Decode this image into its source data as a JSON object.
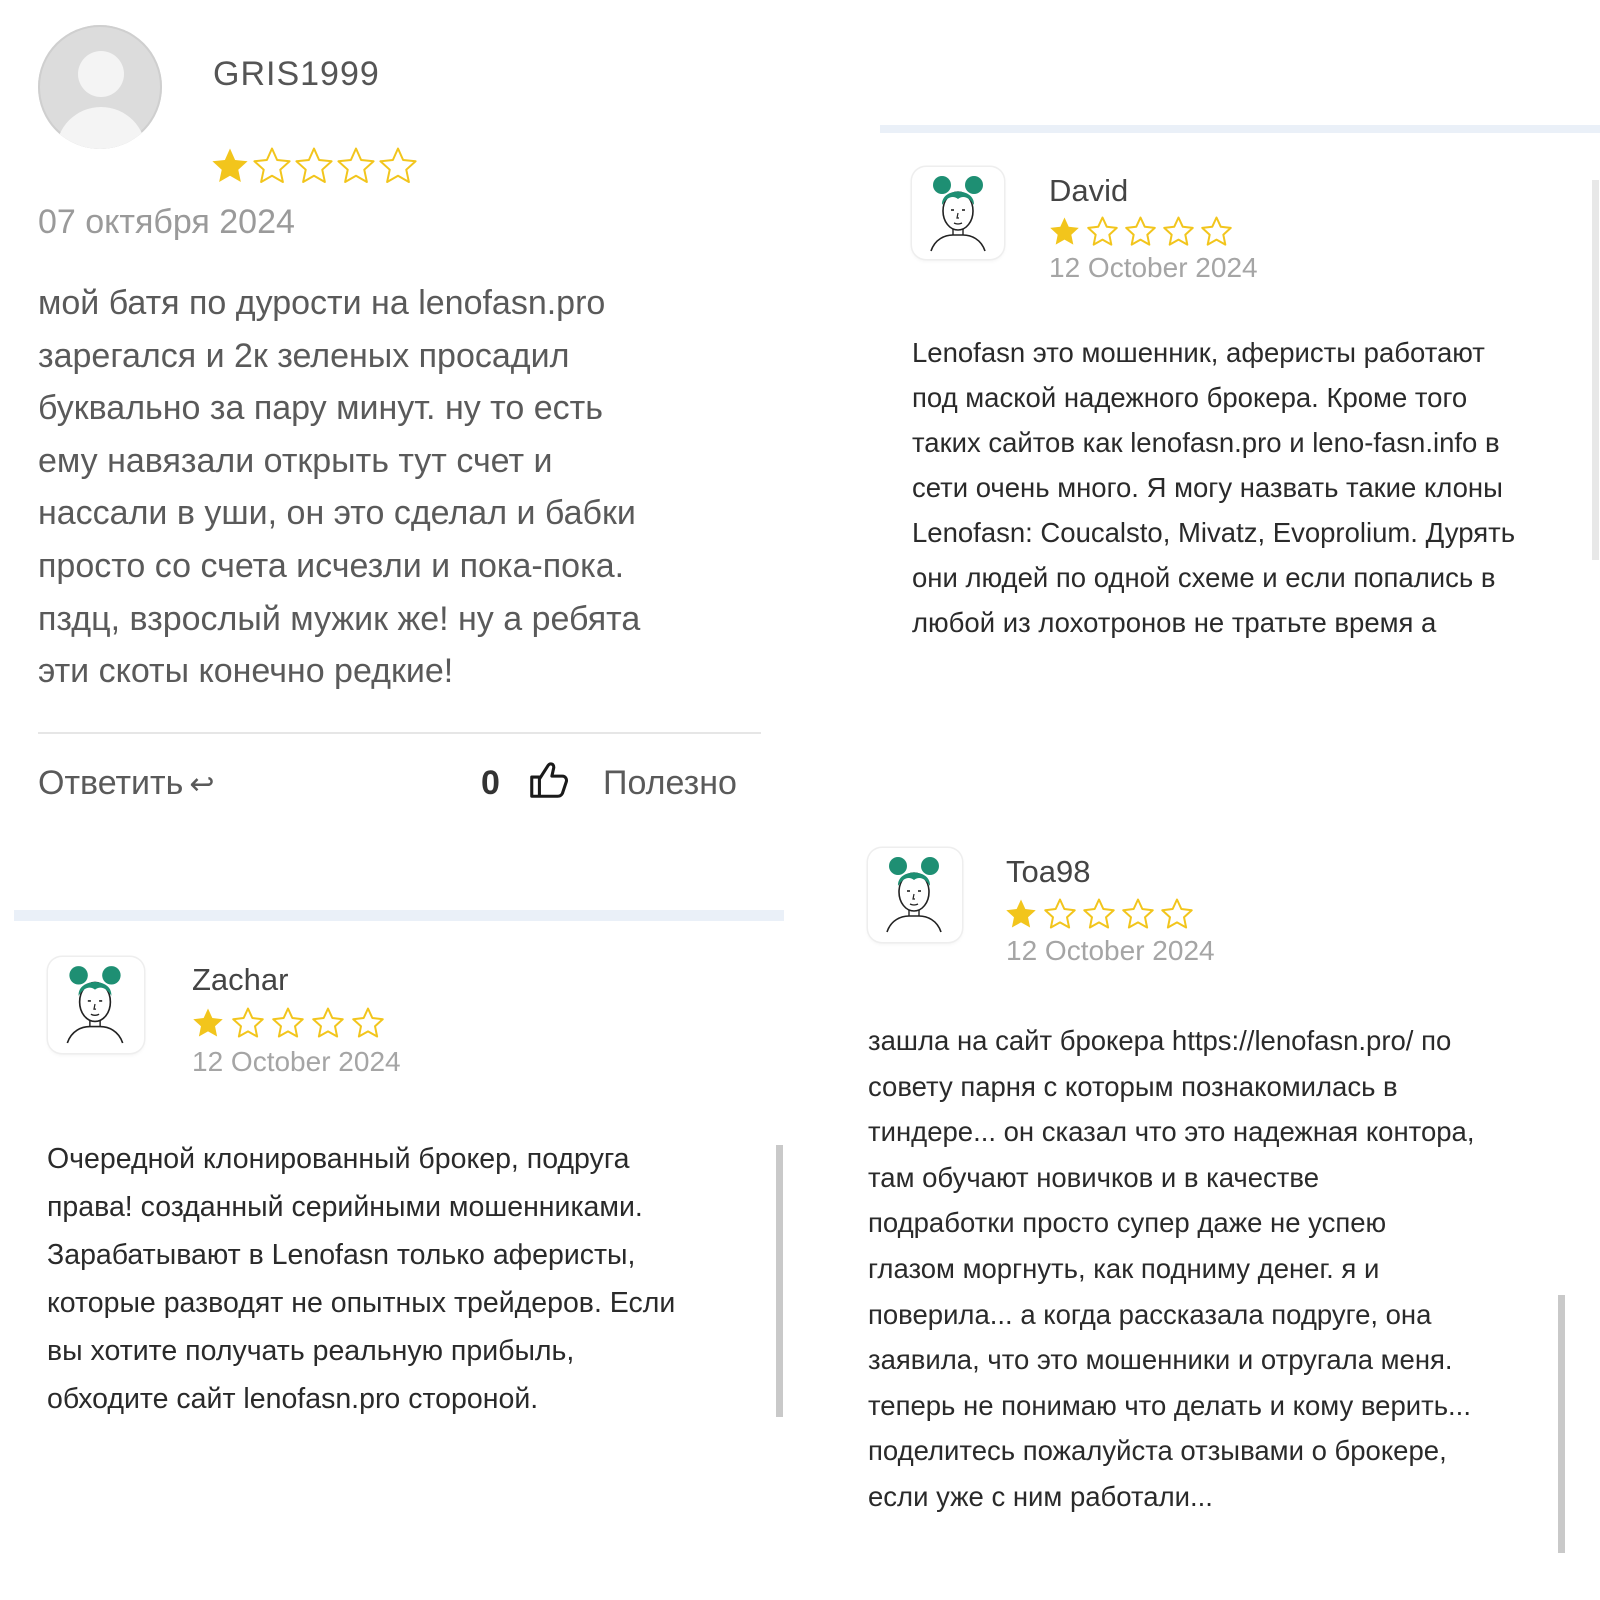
{
  "colors": {
    "star_filled": "#f2c51c",
    "star_empty_stroke": "#f2c51c",
    "avatar_hair": "#1e8f73"
  },
  "review_gris": {
    "username": "GRIS1999",
    "rating": 1,
    "rating_max": 5,
    "date": "07 октября 2024",
    "text_lines": [
      "мой батя по дурости на lenofasn.pro",
      "зарегался и 2к зеленых просадил",
      "буквально за пару минут. ну то есть",
      "ему навязали открыть тут счет и",
      "нассали в уши, он это сделал и бабки",
      "просто со счета исчезли и пока-пока.",
      "пздц, взрослый мужик же! ну а ребята",
      "эти скоты конечно редкие!"
    ],
    "reply_label": "Ответить",
    "reply_icon": "reply-arrow-icon",
    "likes_count": "0",
    "thumb_icon": "thumbs-up-icon",
    "useful_label": "Полезно"
  },
  "review_david": {
    "username": "David",
    "rating": 1,
    "rating_max": 5,
    "date": "12 October 2024",
    "text_lines": [
      "Lenofasn это мошенник, аферисты работают",
      "под маской надежного брокера. Кроме того",
      "таких сайтов как lenofasn.pro и leno-fasn.info в",
      "сети очень много. Я могу назвать такие клоны",
      "Lenofasn: Coucalsto, Mivatz, Evoprolium. Дурять",
      "они людей по одной схеме и если попались в",
      "любой из лохотронов не тратьте время а"
    ]
  },
  "review_zachar": {
    "username": "Zachar",
    "rating": 1,
    "rating_max": 5,
    "date": "12 October 2024",
    "text_lines": [
      "Очередной клонированный брокер, подруга",
      "права! созданный серийными мошенниками.",
      "Зарабатывают в Lenofasn только аферисты,",
      "которые разводят не опытных трейдеров. Если",
      "вы хотите получать реальную прибыль,",
      "обходите сайт lenofasn.pro стороной."
    ]
  },
  "review_toa": {
    "username": "Toa98",
    "rating": 1,
    "rating_max": 5,
    "date": "12 October 2024",
    "text_lines": [
      "зашла на сайт брокера https://lenofasn.pro/ по",
      "совету парня с которым познакомилась в",
      "тиндере... он сказал что это надежная контора,",
      "там обучают новичков и в качестве",
      "подработки просто супер даже не успею",
      "глазом моргнуть, как подниму денег. я и",
      "поверила... а когда рассказала подруге, она",
      "заявила, что это мошенники и отругала меня.",
      "теперь не понимаю что делать и кому верить...",
      "поделитесь пожалуйста отзывами о брокере,",
      "если уже с ним работали..."
    ]
  }
}
